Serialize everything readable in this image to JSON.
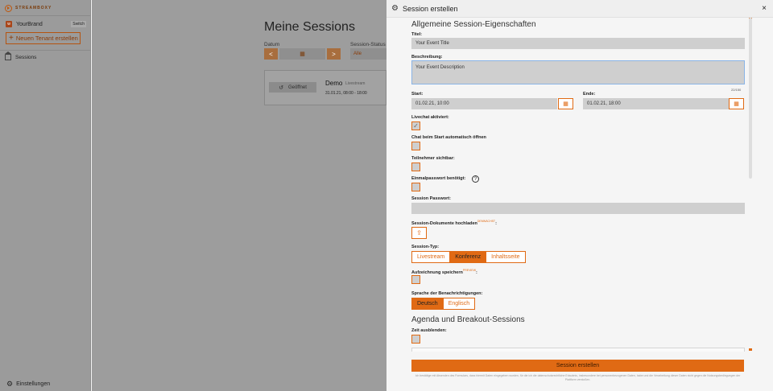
{
  "sidebar": {
    "logo_text": "STREAMBOXY",
    "brand_badge": "w",
    "brand_name": "YourBrand",
    "switch_label": "Switch",
    "new_tenant_plus": "+",
    "new_tenant_label": "Neuen Tenant erstellen",
    "nav_sessions": "Sessions",
    "settings_label": "Einstellungen"
  },
  "main": {
    "title": "Meine Sessions",
    "filter_date_label": "Datum",
    "filter_status_label": "Session-Status",
    "date_prev": "<",
    "date_next": ">",
    "status_value": "Alle",
    "card": {
      "button_label": "Geöffnet",
      "title": "Demo",
      "subtitle": "Livestream",
      "time": "31.01.21, 08:00 - 18:00"
    }
  },
  "modal": {
    "title": "Session erstellen",
    "close": "×",
    "section_general": "Allgemeine Session-Eigenschaften",
    "title_label": "Titel:",
    "title_value": "Your Event Title",
    "description_label": "Beschreibung:",
    "description_value": "Your Event Description",
    "char_counter": "22/150",
    "start_label": "Start:",
    "start_value": "01.02.21, 10:00",
    "end_label": "Ende:",
    "end_value": "01.02.21, 18:00",
    "livechat_label": "Livechat aktiviert:",
    "livechat_check": "✓",
    "chat_open_label": "Chat beim Start automatisch öffnen",
    "participants_label": "Teilnehmer sichtbar:",
    "otp_label": "Einmalpasswort benötigt:",
    "help_glyph": "?",
    "password_label": "Session Passwort:",
    "documents_label": "Session-Dokumente hochladen",
    "documents_badge": "DEMNÄCHST",
    "documents_colon": ":",
    "type_label": "Session-Typ:",
    "type_options": [
      "Livestream",
      "Konferenz",
      "Inhaltsseite"
    ],
    "type_selected": "Konferenz",
    "recording_label": "Aufzeichnung speichern",
    "recording_badge": "PREVIEW",
    "recording_colon": ":",
    "notification_lang_label": "Sprache der Benachrichtigungen:",
    "lang_options": [
      "Deutsch",
      "Englisch"
    ],
    "lang_selected": "Deutsch",
    "section_agenda": "Agenda und Breakout-Sessions",
    "hide_time_label": "Zeit ausblenden:",
    "submit_label": "Session erstellen",
    "legal_text": "Ich bestätige mit Absenden des Formulars, dass hiermit Daten eingegeben wurden, für die ich die datenschutzrechtliche Erlaubnis, insbesondere bei personenbezogenen Daten, habe und die Verarbeitung dieser Daten nicht gegen die Nutzungsbedingungen der Plattform verstoßen."
  },
  "colors": {
    "accent": "#e06a14",
    "overlay": "#9d9d9d",
    "panel": "#f5f5f5"
  },
  "icons": {
    "modal_header": "gear-icon",
    "calendar": "calendar-icon",
    "upload": "upload-icon",
    "help": "help-circle-icon",
    "settings": "gear-icon",
    "nav": "home-icon"
  }
}
